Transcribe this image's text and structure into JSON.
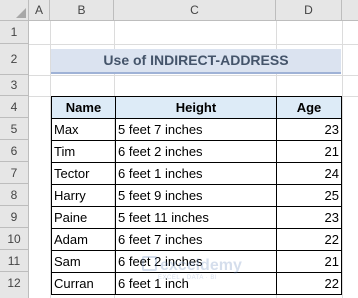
{
  "columns": [
    "A",
    "B",
    "C",
    "D"
  ],
  "rows": [
    "1",
    "2",
    "3",
    "4",
    "5",
    "6",
    "7",
    "8",
    "9",
    "10",
    "11",
    "12"
  ],
  "title": "Use of INDIRECT-ADDRESS",
  "table": {
    "headers": [
      "Name",
      "Height",
      "Age"
    ],
    "rows": [
      {
        "name": "Max",
        "height": "5 feet 7 inches",
        "age": "23"
      },
      {
        "name": "Tim",
        "height": "6 feet 2 inches",
        "age": "21"
      },
      {
        "name": "Tector",
        "height": "6 feet 1 inches",
        "age": "24"
      },
      {
        "name": "Harry",
        "height": "5 feet 9 inches",
        "age": "25"
      },
      {
        "name": "Paine",
        "height": "5 feet 11 inches",
        "age": "23"
      },
      {
        "name": "Adam",
        "height": "6 feet 7 inches",
        "age": "22"
      },
      {
        "name": "Sam",
        "height": "6 feet 2 inches",
        "age": "21"
      },
      {
        "name": "Curran",
        "height": "6 feet 1 inch",
        "age": "22"
      }
    ]
  },
  "watermark": {
    "brand": "exceldemy",
    "tagline": "EXCEL · DATA · BI"
  }
}
